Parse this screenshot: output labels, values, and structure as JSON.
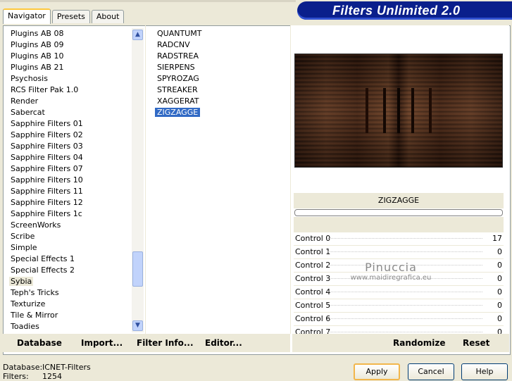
{
  "tabs": [
    {
      "label": "Navigator",
      "active": true
    },
    {
      "label": "Presets",
      "active": false
    },
    {
      "label": "About",
      "active": false
    }
  ],
  "app_title": "Filters Unlimited 2.0",
  "categories": [
    "Plugins AB 08",
    "Plugins AB 09",
    "Plugins AB 10",
    "Plugins AB 21",
    "Psychosis",
    "RCS Filter Pak 1.0",
    "Render",
    "Sabercat",
    "Sapphire Filters 01",
    "Sapphire Filters 02",
    "Sapphire Filters 03",
    "Sapphire Filters 04",
    "Sapphire Filters 07",
    "Sapphire Filters 10",
    "Sapphire Filters 11",
    "Sapphire Filters 12",
    "Sapphire Filters 1c",
    "ScreenWorks",
    "Scribe",
    "Simple",
    "Special Effects 1",
    "Special Effects 2",
    "Sybia",
    "Teph's Tricks",
    "Texturize",
    "Tile & Mirror",
    "Toadies"
  ],
  "selected_category": "Sybia",
  "filters": [
    "QUANTUMT",
    "RADCNV",
    "RADSTREA",
    "SIERPENS",
    "SPYROZAG",
    "STREAKER",
    "XAGGERAT",
    "ZIGZAGGE"
  ],
  "selected_filter": "ZIGZAGGE",
  "filter_name": "ZIGZAGGE",
  "controls": [
    {
      "label": "Control 0",
      "value": "17"
    },
    {
      "label": "Control 1",
      "value": "0"
    },
    {
      "label": "Control 2",
      "value": "0"
    },
    {
      "label": "Control 3",
      "value": "0"
    },
    {
      "label": "Control 4",
      "value": "0"
    },
    {
      "label": "Control 5",
      "value": "0"
    },
    {
      "label": "Control 6",
      "value": "0"
    },
    {
      "label": "Control 7",
      "value": "0"
    }
  ],
  "bottom_left_buttons": {
    "database": "Database",
    "import": "Import...",
    "filter_info": "Filter Info...",
    "editor": "Editor..."
  },
  "bottom_right_buttons": {
    "randomize": "Randomize",
    "reset": "Reset"
  },
  "status": {
    "database_label": "Database:",
    "database_value": "ICNET-Filters",
    "filters_label": "Filters:",
    "filters_value": "1254"
  },
  "dialog_buttons": {
    "apply": "Apply",
    "cancel": "Cancel",
    "help": "Help"
  },
  "watermark": {
    "line1": "Pinuccia",
    "line2": "www.maidiregrafica.eu"
  }
}
